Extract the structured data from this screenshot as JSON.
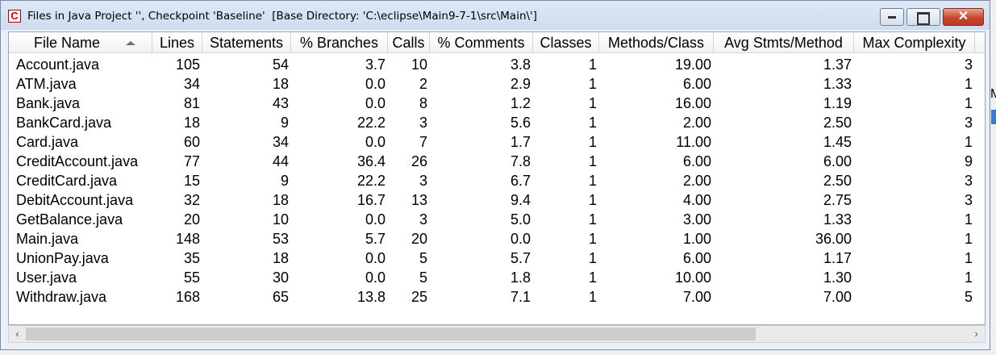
{
  "window": {
    "title": "Files in Java Project '', Checkpoint 'Baseline'  [Base Directory: 'C:\\eclipse\\Main9-7-1\\src\\Main\\']",
    "app_icon_letter": "C",
    "controls": {
      "close_glyph": "✕"
    }
  },
  "table": {
    "columns": [
      "File Name",
      "Lines",
      "Statements",
      "% Branches",
      "Calls",
      "% Comments",
      "Classes",
      "Methods/Class",
      "Avg Stmts/Method",
      "Max Complexity"
    ],
    "sort_column": "File Name",
    "rows": [
      [
        "Account.java",
        "105",
        "54",
        "3.7",
        "10",
        "3.8",
        "1",
        "19.00",
        "1.37",
        "3"
      ],
      [
        "ATM.java",
        "34",
        "18",
        "0.0",
        "2",
        "2.9",
        "1",
        "6.00",
        "1.33",
        "1"
      ],
      [
        "Bank.java",
        "81",
        "43",
        "0.0",
        "8",
        "1.2",
        "1",
        "16.00",
        "1.19",
        "1"
      ],
      [
        "BankCard.java",
        "18",
        "9",
        "22.2",
        "3",
        "5.6",
        "1",
        "2.00",
        "2.50",
        "3"
      ],
      [
        "Card.java",
        "60",
        "34",
        "0.0",
        "7",
        "1.7",
        "1",
        "11.00",
        "1.45",
        "1"
      ],
      [
        "CreditAccount.java",
        "77",
        "44",
        "36.4",
        "26",
        "7.8",
        "1",
        "6.00",
        "6.00",
        "9"
      ],
      [
        "CreditCard.java",
        "15",
        "9",
        "22.2",
        "3",
        "6.7",
        "1",
        "2.00",
        "2.50",
        "3"
      ],
      [
        "DebitAccount.java",
        "32",
        "18",
        "16.7",
        "13",
        "9.4",
        "1",
        "4.00",
        "2.75",
        "3"
      ],
      [
        "GetBalance.java",
        "20",
        "10",
        "0.0",
        "3",
        "5.0",
        "1",
        "3.00",
        "1.33",
        "1"
      ],
      [
        "Main.java",
        "148",
        "53",
        "5.7",
        "20",
        "0.0",
        "1",
        "1.00",
        "36.00",
        "1"
      ],
      [
        "UnionPay.java",
        "35",
        "18",
        "0.0",
        "5",
        "5.7",
        "1",
        "6.00",
        "1.17",
        "1"
      ],
      [
        "User.java",
        "55",
        "30",
        "0.0",
        "5",
        "1.8",
        "1",
        "10.00",
        "1.30",
        "1"
      ],
      [
        "Withdraw.java",
        "168",
        "65",
        "13.8",
        "25",
        "7.1",
        "1",
        "7.00",
        "7.00",
        "5"
      ]
    ]
  },
  "scrollbar": {
    "left_arrow": "‹",
    "right_arrow": "›"
  },
  "background": {
    "right_edge_glyph": "M"
  }
}
